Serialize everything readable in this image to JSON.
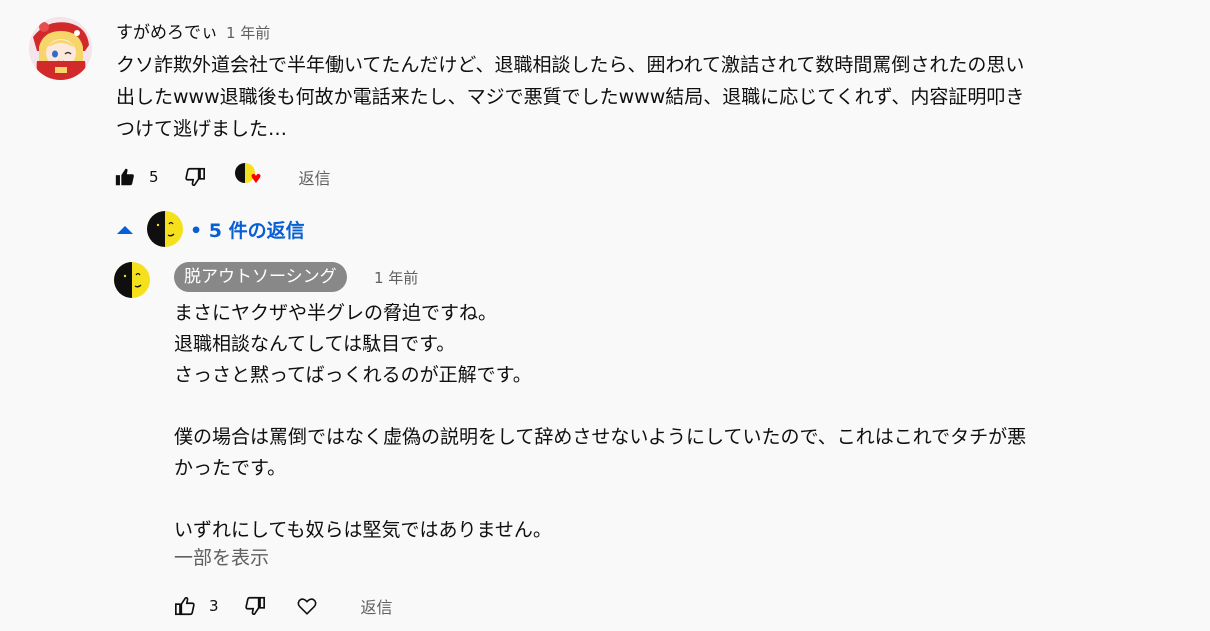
{
  "comment": {
    "author": "すがめろでぃ",
    "time": "1 年前",
    "text": "クソ詐欺外道会社で半年働いてたんだけど、退職相談したら、囲われて激詰されて数時間罵倒されたの思い\n出したwww退職後も何故か電話来たし、マジで悪質でしたwww結局、退職に応じてくれず、内容証明叩き\nつけて逃げました…",
    "like_count": "5",
    "reply_label": "返信",
    "like_icon": "thumb-up-filled-icon",
    "dislike_icon": "thumb-down-icon",
    "creator_heart_icon": "creator-heart-icon",
    "heart_color": "#ff0000"
  },
  "replies_toggle": {
    "label": "• 5 件の返信",
    "icon": "chevron-up-icon",
    "color": "#065fd4"
  },
  "reply": {
    "author": "脱アウトソーシング",
    "time": "1 年前",
    "text": "まさにヤクザや半グレの脅迫ですね。\n退職相談なんてしては駄目です。\nさっさと黙ってばっくれるのが正解です。\n\n僕の場合は罵倒ではなく虚偽の説明をして辞めさせないようにしていたので、これはこれでタチが悪\nかったです。\n\nいずれにしても奴らは堅気ではありません。",
    "show_more": "一部を表示",
    "like_count": "3",
    "reply_label": "返信",
    "like_icon": "thumb-up-outline-icon",
    "dislike_icon": "thumb-down-icon",
    "heart_icon": "heart-outline-icon"
  }
}
